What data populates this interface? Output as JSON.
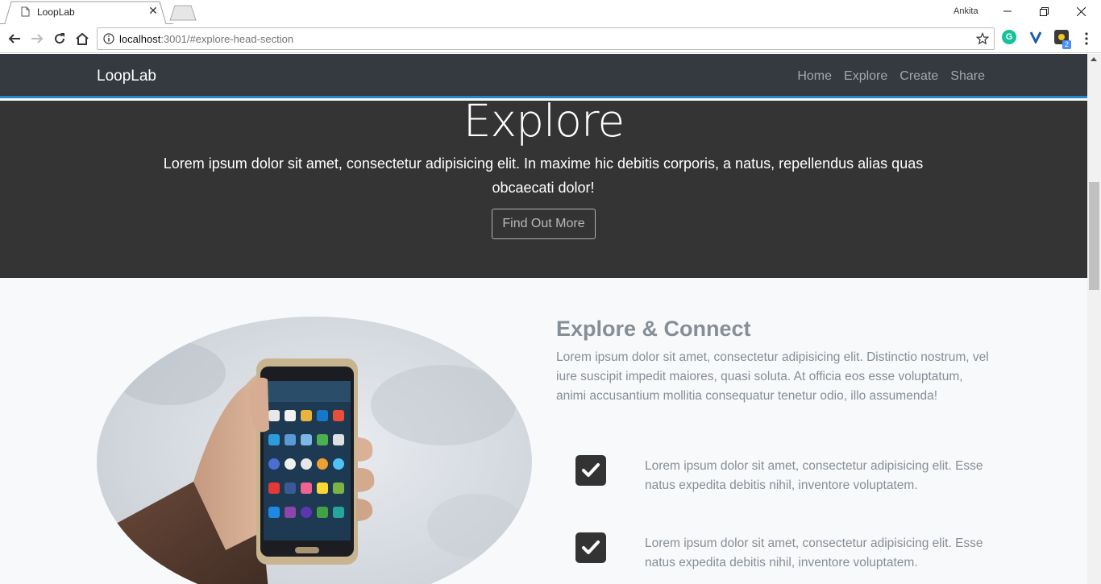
{
  "browser": {
    "tab_title": "LoopLab",
    "profile_name": "Ankita",
    "url_host": "localhost",
    "url_rest": ":3001/#explore-head-section",
    "extension_badge": "2"
  },
  "navbar": {
    "brand": "LoopLab",
    "links": [
      "Home",
      "Explore",
      "Create",
      "Share"
    ]
  },
  "hero": {
    "title": "Explore",
    "text": "Lorem ipsum dolor sit amet, consectetur adipisicing elit. In maxime hic debitis corporis, a natus, repellendus alias quas obcaecati dolor!",
    "button": "Find Out More"
  },
  "feature": {
    "title": "Explore & Connect",
    "text": "Lorem ipsum dolor sit amet, consectetur adipisicing elit. Distinctio nostrum, vel iure suscipit impedit maiores, quasi soluta. At officia eos esse voluptatum, animi accusantium mollitia consequatur tenetur odio, illo assumenda!",
    "checks": [
      "Lorem ipsum dolor sit amet, consectetur adipisicing elit. Esse natus expedita debitis nihil, inventore voluptatem.",
      "Lorem ipsum dolor sit amet, consectetur adipisicing elit. Esse natus expedita debitis nihil, inventore voluptatem."
    ]
  },
  "colors": {
    "navbar_bg": "#343a40",
    "navbar_accent": "#1e88c8",
    "hero_bg": "#343434",
    "section_bg": "#f8f9fa",
    "muted_text": "#868e96"
  },
  "icons": [
    "page-icon",
    "close-icon",
    "back-icon",
    "forward-icon",
    "reload-icon",
    "home-icon",
    "info-icon",
    "star-icon",
    "grammarly-icon",
    "extension-v-icon",
    "extension-badge-icon",
    "menu-icon",
    "check-icon"
  ]
}
